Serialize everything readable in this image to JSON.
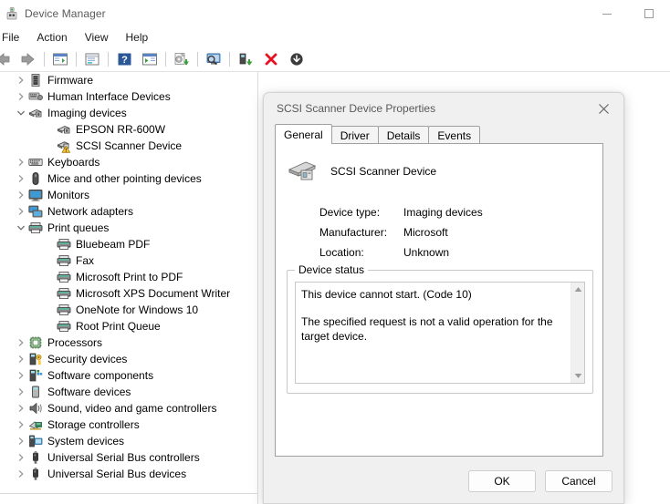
{
  "window": {
    "title": "Device Manager",
    "icon": "device-manager-icon",
    "controls": {
      "minimize": "minimize-icon",
      "maximize": "maximize-icon"
    }
  },
  "menubar": {
    "items": [
      {
        "label": "File"
      },
      {
        "label": "Action"
      },
      {
        "label": "View"
      },
      {
        "label": "Help"
      }
    ]
  },
  "toolbar": {
    "buttons": [
      {
        "name": "back-icon"
      },
      {
        "name": "forward-icon"
      },
      {
        "name": "show-hide-console-tree-icon"
      },
      {
        "name": "properties-window-icon"
      },
      {
        "name": "help-icon"
      },
      {
        "name": "scan-for-hardware-changes-icon"
      },
      {
        "name": "update-driver-icon"
      },
      {
        "name": "show-hidden-devices-icon"
      },
      {
        "name": "device-properties-icon"
      },
      {
        "name": "uninstall-device-icon"
      },
      {
        "name": "disable-device-icon"
      }
    ]
  },
  "tree": {
    "items": [
      {
        "label": "Firmware",
        "indent": 0,
        "expander": "collapsed",
        "icon": "firmware-icon"
      },
      {
        "label": "Human Interface Devices",
        "indent": 0,
        "expander": "collapsed",
        "icon": "hid-icon"
      },
      {
        "label": "Imaging devices",
        "indent": 0,
        "expander": "expanded",
        "icon": "imaging-icon"
      },
      {
        "label": "EPSON RR-600W",
        "indent": 1,
        "expander": "none",
        "icon": "imaging-icon"
      },
      {
        "label": "SCSI Scanner Device",
        "indent": 1,
        "expander": "none",
        "icon": "imaging-warning-icon"
      },
      {
        "label": "Keyboards",
        "indent": 0,
        "expander": "collapsed",
        "icon": "keyboard-icon"
      },
      {
        "label": "Mice and other pointing devices",
        "indent": 0,
        "expander": "collapsed",
        "icon": "mouse-icon"
      },
      {
        "label": "Monitors",
        "indent": 0,
        "expander": "collapsed",
        "icon": "monitor-icon"
      },
      {
        "label": "Network adapters",
        "indent": 0,
        "expander": "collapsed",
        "icon": "network-icon"
      },
      {
        "label": "Print queues",
        "indent": 0,
        "expander": "expanded",
        "icon": "printer-icon"
      },
      {
        "label": "Bluebeam PDF",
        "indent": 1,
        "expander": "none",
        "icon": "printer-icon"
      },
      {
        "label": "Fax",
        "indent": 1,
        "expander": "none",
        "icon": "printer-icon"
      },
      {
        "label": "Microsoft Print to PDF",
        "indent": 1,
        "expander": "none",
        "icon": "printer-icon"
      },
      {
        "label": "Microsoft XPS Document Writer",
        "indent": 1,
        "expander": "none",
        "icon": "printer-icon"
      },
      {
        "label": "OneNote for Windows 10",
        "indent": 1,
        "expander": "none",
        "icon": "printer-icon"
      },
      {
        "label": "Root Print Queue",
        "indent": 1,
        "expander": "none",
        "icon": "printer-icon"
      },
      {
        "label": "Processors",
        "indent": 0,
        "expander": "collapsed",
        "icon": "processor-icon"
      },
      {
        "label": "Security devices",
        "indent": 0,
        "expander": "collapsed",
        "icon": "security-icon"
      },
      {
        "label": "Software components",
        "indent": 0,
        "expander": "collapsed",
        "icon": "software-component-icon"
      },
      {
        "label": "Software devices",
        "indent": 0,
        "expander": "collapsed",
        "icon": "software-device-icon"
      },
      {
        "label": "Sound, video and game controllers",
        "indent": 0,
        "expander": "collapsed",
        "icon": "sound-icon"
      },
      {
        "label": "Storage controllers",
        "indent": 0,
        "expander": "collapsed",
        "icon": "storage-icon"
      },
      {
        "label": "System devices",
        "indent": 0,
        "expander": "collapsed",
        "icon": "system-device-icon"
      },
      {
        "label": "Universal Serial Bus controllers",
        "indent": 0,
        "expander": "collapsed",
        "icon": "usb-icon"
      },
      {
        "label": "Universal Serial Bus devices",
        "indent": 0,
        "expander": "collapsed",
        "icon": "usb-icon"
      }
    ]
  },
  "dialog": {
    "title": "SCSI Scanner Device Properties",
    "close_icon": "close-icon",
    "tabs": [
      {
        "label": "General",
        "active": true
      },
      {
        "label": "Driver",
        "active": false
      },
      {
        "label": "Details",
        "active": false
      },
      {
        "label": "Events",
        "active": false
      }
    ],
    "device": {
      "icon": "scanner-icon",
      "name": "SCSI Scanner Device",
      "fields": [
        {
          "key": "Device type:",
          "value": "Imaging devices"
        },
        {
          "key": "Manufacturer:",
          "value": "Microsoft"
        },
        {
          "key": "Location:",
          "value": "Unknown"
        }
      ]
    },
    "status_group": {
      "legend": "Device status",
      "lines": [
        "This device cannot start. (Code 10)",
        "The specified request is not a valid operation for the target device."
      ],
      "scroll_up_icon": "scroll-up-arrow-icon",
      "scroll_down_icon": "scroll-down-arrow-icon"
    },
    "buttons": {
      "ok": "OK",
      "cancel": "Cancel"
    }
  },
  "colors": {
    "accent_blue": "#2b5797",
    "warning_yellow": "#ffc83d",
    "error_red": "#e81123",
    "dialog_bg": "#f0f0f0",
    "window_bg": "#ffffff"
  }
}
